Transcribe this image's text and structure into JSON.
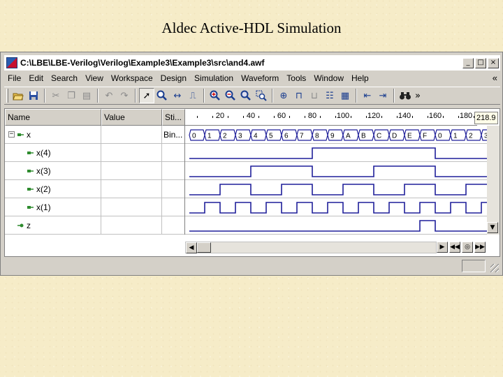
{
  "slide_title": "Aldec Active-HDL Simulation",
  "window": {
    "title": "C:\\LBE\\LBE-Verilog\\Verilog\\Example3\\Example3\\src\\and4.awf",
    "minimize_icon": "minimize-icon",
    "maximize_icon": "maximize-icon",
    "close_icon": "close-icon"
  },
  "menu": [
    "File",
    "Edit",
    "Search",
    "View",
    "Workspace",
    "Design",
    "Simulation",
    "Waveform",
    "Tools",
    "Window",
    "Help"
  ],
  "menu_more": "«",
  "toolbar": {
    "icons": [
      "open-folder-icon",
      "save-icon",
      "cut-icon",
      "copy-icon",
      "paste-icon",
      "undo-icon",
      "redo-icon",
      "select-pointer-icon",
      "find-icon",
      "measure-icon",
      "edit-waveform-icon",
      "zoom-in-icon",
      "zoom-out-icon",
      "zoom-fit-icon",
      "zoom-area-icon",
      "add-signal-icon",
      "stimulators-icon",
      "signal-properties-icon",
      "list-icon",
      "align-left-icon",
      "align-right-icon",
      "binoculars-icon"
    ],
    "more": "»"
  },
  "columns": {
    "name": "Name",
    "value": "Value",
    "stimulator": "Sti..."
  },
  "ruler": {
    "labels": [
      "20",
      "40",
      "60",
      "80",
      "100",
      "120",
      "140",
      "160",
      "180"
    ],
    "cursor_time": "218.9"
  },
  "signals": [
    {
      "name": "x",
      "expand": "−",
      "stimulator": "Bin...",
      "type": "bus",
      "icon": "input-port-icon",
      "bus_values": [
        "0",
        "1",
        "2",
        "3",
        "4",
        "5",
        "6",
        "7",
        "8",
        "9",
        "A",
        "B",
        "C",
        "D",
        "E",
        "F",
        "0",
        "1",
        "2",
        "3"
      ]
    },
    {
      "name": "x(4)",
      "type": "bit",
      "icon": "input-port-icon",
      "period": 160,
      "start": 0
    },
    {
      "name": "x(3)",
      "type": "bit",
      "icon": "input-port-icon",
      "period": 80,
      "start": 0
    },
    {
      "name": "x(2)",
      "type": "bit",
      "icon": "input-port-icon",
      "period": 40,
      "start": 0
    },
    {
      "name": "x(1)",
      "type": "bit",
      "icon": "input-port-icon",
      "period": 20,
      "start": 0
    },
    {
      "name": "z",
      "type": "bit",
      "icon": "output-port-icon",
      "high_from": 150,
      "high_to": 160
    }
  ],
  "time_axis": {
    "min": 0,
    "max": 195,
    "unit_per_state": 10
  },
  "colors": {
    "wave": "#1f1f9a",
    "input_icon": "#2e8b2e",
    "output_icon": "#2e8b2e"
  },
  "scroll_icons": {
    "left": "arrow-left-icon",
    "right": "arrow-right-icon",
    "up": "arrow-up-icon",
    "down": "arrow-down-icon"
  }
}
